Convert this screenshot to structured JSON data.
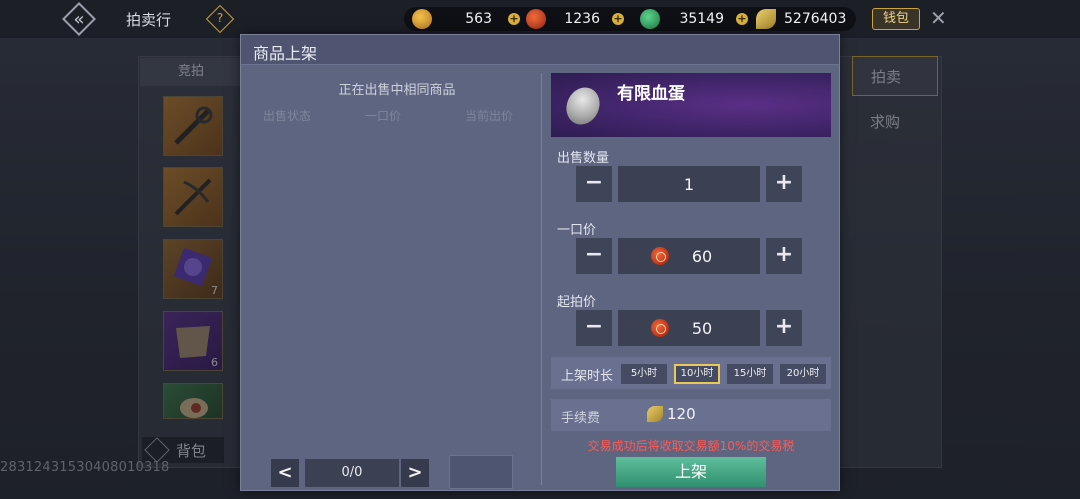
{
  "topbar": {
    "title": "拍卖行",
    "help": "?",
    "currencies": [
      {
        "icon": "gold-medal-icon",
        "value": "563"
      },
      {
        "icon": "red-coin-icon",
        "value": "1236"
      },
      {
        "icon": "jade-coin-icon",
        "value": "35149"
      },
      {
        "icon": "leaf-gold-icon",
        "value": "5276403"
      }
    ],
    "wallet_label": "钱包"
  },
  "background": {
    "auction_tab": "竞拍",
    "bag_items": [
      {
        "icon": "staff-icon",
        "count": ""
      },
      {
        "icon": "crossbow-icon",
        "count": ""
      },
      {
        "icon": "purple-orb-icon",
        "count": "7"
      },
      {
        "icon": "hide-icon",
        "count": "6"
      },
      {
        "icon": "meat-icon",
        "count": ""
      }
    ],
    "bag_label": "背包",
    "right_tabs": [
      "拍卖",
      "求购"
    ],
    "user_id": "28312431530408010318"
  },
  "dialog": {
    "title": "商品上架",
    "same_items_title": "正在出售中相同商品",
    "columns": [
      "出售状态",
      "一口价",
      "当前出价"
    ],
    "pager": {
      "value": "0/0",
      "prev": "<",
      "next": ">"
    },
    "item": {
      "name": "有限血蛋",
      "icon": "blood-egg-icon"
    },
    "quantity": {
      "label": "出售数量",
      "value": "1"
    },
    "buyout": {
      "label": "一口价",
      "value": "60"
    },
    "start_price": {
      "label": "起拍价",
      "value": "50"
    },
    "duration": {
      "label": "上架时长",
      "options": [
        "5小时",
        "10小时",
        "15小时",
        "20小时"
      ],
      "selected": "10小时"
    },
    "fee": {
      "label": "手续费",
      "value": "120"
    },
    "tax_note": "交易成功后将收取交易额10%的交易税",
    "list_button": "上架",
    "minus": "−",
    "plus": "+"
  }
}
